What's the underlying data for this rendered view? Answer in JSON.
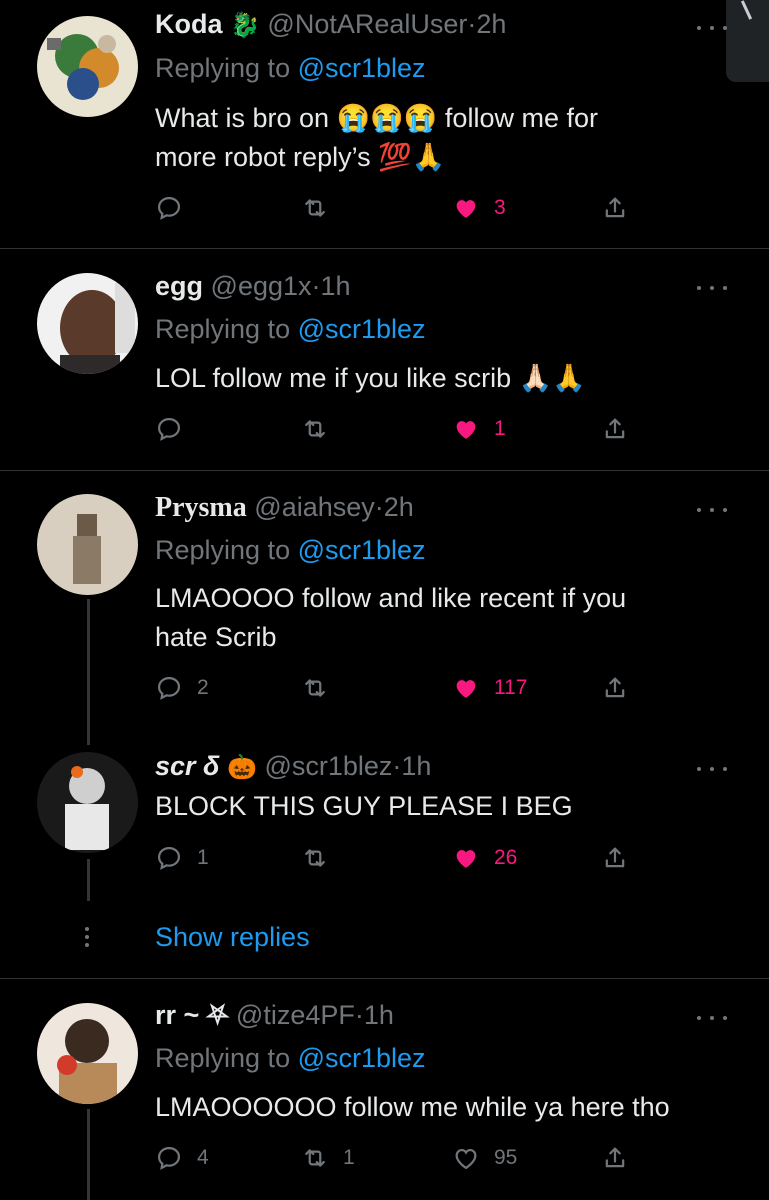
{
  "replies": [
    {
      "name": "Koda",
      "name_emoji": "🐉",
      "handle": "@NotARealUser",
      "sep": "·",
      "time": "2h",
      "replying_prefix": "Replying to",
      "replying_to": "@scr1blez",
      "text_line1": "What is bro on 😭😭😭 follow me for",
      "text_line2": "more robot reply’s 💯🙏",
      "replies_count": "",
      "retweets_count": "",
      "likes_count": "3",
      "liked": true
    },
    {
      "name": "egg",
      "handle": "@egg1x",
      "sep": "·",
      "time": "1h",
      "replying_prefix": "Replying to",
      "replying_to": "@scr1blez",
      "text_line1": "LOL follow me if you like scrib 🙏🏻🙏",
      "replies_count": "",
      "retweets_count": "",
      "likes_count": "1",
      "liked": true
    },
    {
      "name": "Prysma",
      "handle": "@aiahsey",
      "sep": "·",
      "time": "2h",
      "replying_prefix": "Replying to",
      "replying_to": "@scr1blez",
      "text_line1": "LMAOOOO follow and like recent if you",
      "text_line2": "hate Scrib",
      "replies_count": "2",
      "retweets_count": "",
      "likes_count": "117",
      "liked": true
    },
    {
      "name": "scr δ",
      "name_emoji": "🎃",
      "handle": "@scr1blez",
      "sep": "·",
      "time": "1h",
      "text_line1": "BLOCK THIS GUY PLEASE I BEG",
      "replies_count": "1",
      "retweets_count": "",
      "likes_count": "26",
      "liked": true
    },
    {
      "name": "rr ~ ⛧",
      "handle": "@tize4PF",
      "sep": "·",
      "time": "1h",
      "replying_prefix": "Replying to",
      "replying_to": "@scr1blez",
      "text_line1": "LMAOOOOOO follow me while ya here tho",
      "replies_count": "4",
      "retweets_count": "1",
      "likes_count": "95",
      "liked": false
    }
  ],
  "show_replies": "Show replies",
  "colors": {
    "background": "#000000",
    "link": "#1d9bf0",
    "muted": "#71767b",
    "like": "#f91880",
    "divider": "#2f3336"
  },
  "icons": [
    "reply-icon",
    "retweet-icon",
    "heart-icon",
    "share-icon",
    "more-icon"
  ]
}
